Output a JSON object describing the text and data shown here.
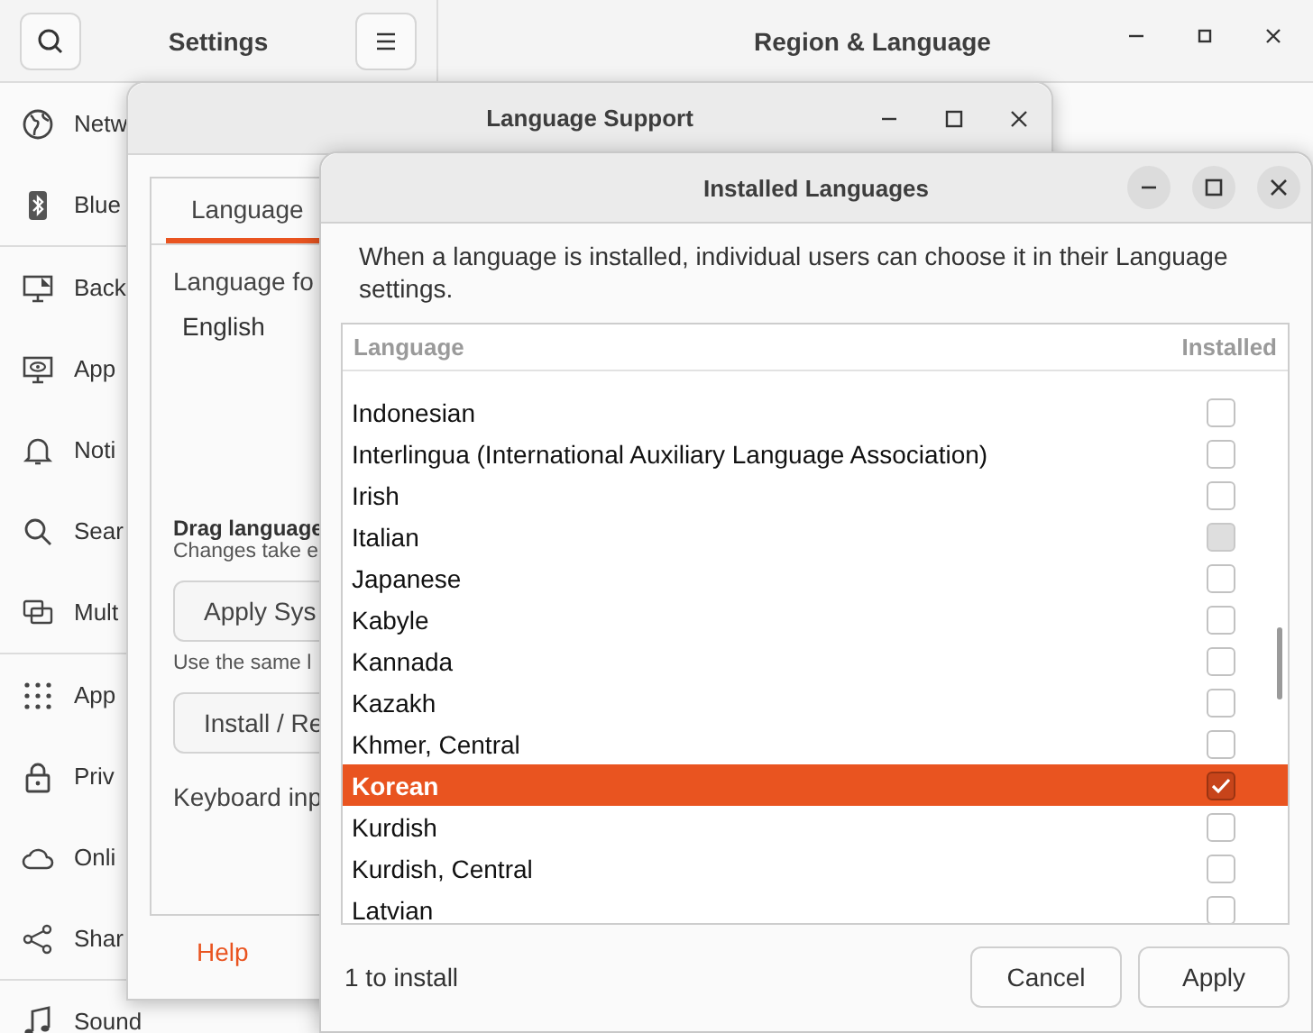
{
  "settings": {
    "title": "Settings",
    "page_title": "Region & Language",
    "sidebar": [
      [
        {
          "label": "Netw"
        },
        {
          "label": "Blue"
        }
      ],
      [
        {
          "label": "Back"
        },
        {
          "label": "App"
        },
        {
          "label": "Noti"
        },
        {
          "label": "Sear"
        },
        {
          "label": "Mult"
        }
      ],
      [
        {
          "label": "App"
        },
        {
          "label": "Priv"
        },
        {
          "label": "Onli"
        },
        {
          "label": "Shar"
        }
      ],
      [
        {
          "label": "Sound"
        }
      ]
    ]
  },
  "language_support": {
    "title": "Language Support",
    "tabs": [
      {
        "label": "Language",
        "selected": true
      }
    ],
    "language_for_label": "Language fo",
    "language_value": "English",
    "drag_hint": "Drag language",
    "changes_note": "Changes take e",
    "apply_system_button": "Apply Sys",
    "same_note": "Use the same l",
    "install_button": "Install / Re",
    "keyboard_label": "Keyboard inp",
    "help_button": "Help"
  },
  "installed_languages": {
    "title": "Installed Languages",
    "description": "When a language is installed, individual users can choose it in their Language settings.",
    "columns": [
      "Language",
      "Installed"
    ],
    "rows": [
      {
        "name": "Indonesian",
        "installed": false,
        "selected": false,
        "disabled": false
      },
      {
        "name": "Interlingua (International Auxiliary Language Association)",
        "installed": false,
        "selected": false,
        "disabled": false
      },
      {
        "name": "Irish",
        "installed": false,
        "selected": false,
        "disabled": false
      },
      {
        "name": "Italian",
        "installed": false,
        "selected": false,
        "disabled": true
      },
      {
        "name": "Japanese",
        "installed": false,
        "selected": false,
        "disabled": false
      },
      {
        "name": "Kabyle",
        "installed": false,
        "selected": false,
        "disabled": false
      },
      {
        "name": "Kannada",
        "installed": false,
        "selected": false,
        "disabled": false
      },
      {
        "name": "Kazakh",
        "installed": false,
        "selected": false,
        "disabled": false
      },
      {
        "name": "Khmer, Central",
        "installed": false,
        "selected": false,
        "disabled": false
      },
      {
        "name": "Korean",
        "installed": true,
        "selected": true,
        "disabled": false
      },
      {
        "name": "Kurdish",
        "installed": false,
        "selected": false,
        "disabled": false
      },
      {
        "name": "Kurdish, Central",
        "installed": false,
        "selected": false,
        "disabled": false
      },
      {
        "name": "Latvian",
        "installed": false,
        "selected": false,
        "disabled": false
      }
    ],
    "status": "1 to install",
    "buttons": [
      "Cancel",
      "Apply"
    ]
  }
}
